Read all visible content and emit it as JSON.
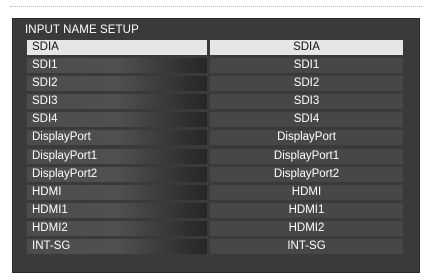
{
  "title": "INPUT NAME SETUP",
  "rows": [
    {
      "name": "SDIA",
      "value": "SDIA",
      "selected": true
    },
    {
      "name": "SDI1",
      "value": "SDI1",
      "selected": false
    },
    {
      "name": "SDI2",
      "value": "SDI2",
      "selected": false
    },
    {
      "name": "SDI3",
      "value": "SDI3",
      "selected": false
    },
    {
      "name": "SDI4",
      "value": "SDI4",
      "selected": false
    },
    {
      "name": "DisplayPort",
      "value": "DisplayPort",
      "selected": false
    },
    {
      "name": "DisplayPort1",
      "value": "DisplayPort1",
      "selected": false
    },
    {
      "name": "DisplayPort2",
      "value": "DisplayPort2",
      "selected": false
    },
    {
      "name": "HDMI",
      "value": "HDMI",
      "selected": false
    },
    {
      "name": "HDMI1",
      "value": "HDMI1",
      "selected": false
    },
    {
      "name": "HDMI2",
      "value": "HDMI2",
      "selected": false
    },
    {
      "name": "INT-SG",
      "value": "INT-SG",
      "selected": false
    }
  ],
  "colors": {
    "panel_background": "#3a3a3a",
    "selected_row": "#e6e6e6",
    "value_cell": "#474747"
  }
}
